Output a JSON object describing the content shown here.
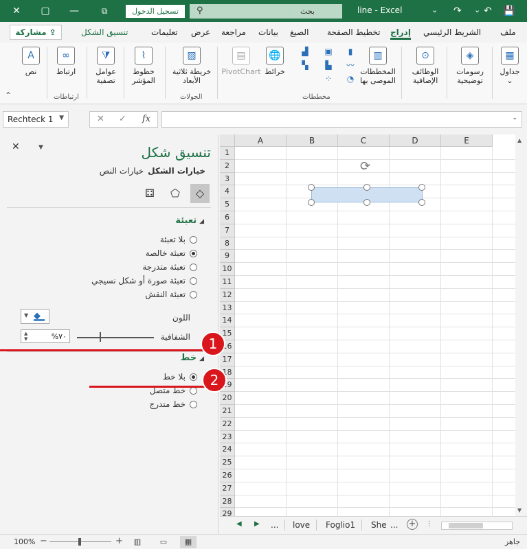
{
  "titlebar": {
    "sign_in": "تسجيل الدخول",
    "search_placeholder": "بحث",
    "window_title": "line - Excel",
    "close_glyph": "✕",
    "restore_glyph": "▢",
    "minimize_glyph": "—"
  },
  "ribbon_tabs": {
    "file": "ملف",
    "home": "الشريط الرئيسي",
    "insert": "إدراج",
    "page_layout": "تخطيط الصفحة",
    "formulas": "الصيغ",
    "data": "بيانات",
    "review": "مراجعة",
    "view": "عرض",
    "help": "تعليمات",
    "shape_format": "تنسيق الشكل",
    "share": "مشاركة"
  },
  "ribbon": {
    "tables": "جداول",
    "illustrations": "رسومات توضيحية",
    "addins": "الوظائف الإضافية",
    "recommended_charts": "المخططات الموصى بها",
    "maps": "خرائط",
    "pivotchart": "PivotChart",
    "map3d": "خريطة ثلاثية الأبعاد",
    "sparklines": "خطوط المؤشر",
    "filters": "عوامل تصفية",
    "link": "ارتباط",
    "text": "نص",
    "group_charts": "مخططات",
    "group_tours": "الجولات",
    "group_links": "ارتباطات"
  },
  "formula_bar": {
    "name_box": "Rechteck 1",
    "fx": "fx",
    "formula_value": ""
  },
  "pane": {
    "title": "تنسيق شكل",
    "tab_shape_options": "خيارات الشكل",
    "tab_text_options": "خيارات النص",
    "fill_section": "تعبئة",
    "fill_options": [
      {
        "label": "بلا تعبئة",
        "checked": false
      },
      {
        "label": "تعبئة خالصة",
        "checked": true
      },
      {
        "label": "تعبئة متدرجة",
        "checked": false
      },
      {
        "label": "تعبئة صورة أو شكل نسيجي",
        "checked": false
      },
      {
        "label": "تعبئة النقش",
        "checked": false
      }
    ],
    "color_label": "اللون",
    "transparency_label": "الشفافية",
    "transparency_value": "%٧٠",
    "line_section": "خط",
    "line_options": [
      {
        "label": "بلا خط",
        "checked": true
      },
      {
        "label": "خط متصل",
        "checked": false
      },
      {
        "label": "خط متدرج",
        "checked": false
      }
    ]
  },
  "annotations": {
    "badge1": "1",
    "badge2": "2"
  },
  "grid": {
    "columns": [
      "A",
      "B",
      "C",
      "D",
      "E"
    ],
    "rows": [
      "1",
      "2",
      "3",
      "4",
      "5",
      "6",
      "7",
      "8",
      "9",
      "10",
      "11",
      "12",
      "13",
      "14",
      "15",
      "16",
      "17",
      "18",
      "19",
      "20",
      "21",
      "22",
      "23",
      "24",
      "25",
      "26",
      "27",
      "28",
      "29"
    ]
  },
  "sheets": {
    "ellipsis": "...",
    "tab1": "love",
    "tab2": "Foglio1",
    "tab3": "She",
    "ellipsis2": "..."
  },
  "status": {
    "zoom": "100%",
    "ready": "جاهز"
  },
  "colors": {
    "accent": "#1e7145",
    "annotation": "#d9161c",
    "shape_fill": "#cfe0f3"
  }
}
